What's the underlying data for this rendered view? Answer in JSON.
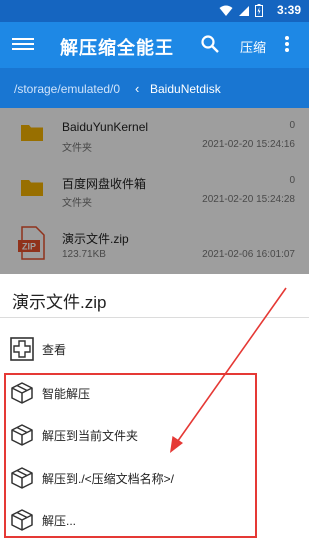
{
  "status_bar": {
    "time": "3:39"
  },
  "app_bar": {
    "title": "解压缩全能王",
    "compress_label": "压缩"
  },
  "path_bar": {
    "path": "/storage/emulated/0",
    "current_folder": "BaiduNetdisk"
  },
  "files": [
    {
      "name": "BaiduYunKernel",
      "type": "文件夹",
      "count": "0",
      "date": "2021-02-20 15:24:16",
      "icon": "folder-icon"
    },
    {
      "name": "百度网盘收件箱",
      "type": "文件夹",
      "count": "0",
      "date": "2021-02-20 15:24:28",
      "icon": "folder-icon"
    },
    {
      "name": "演示文件.zip",
      "size": "123.71KB",
      "date": "2021-02-06 16:01:07",
      "icon": "zip-file-icon",
      "icon_text": "ZIP"
    }
  ],
  "sheet": {
    "title": "演示文件.zip",
    "options": [
      {
        "label": "查看",
        "icon": "plus-square-icon"
      },
      {
        "label": "智能解压",
        "icon": "box-icon"
      },
      {
        "label": "解压到当前文件夹",
        "icon": "box-icon"
      },
      {
        "label": "解压到./<压缩文档名称>/",
        "icon": "box-icon"
      },
      {
        "label": "解压...",
        "icon": "box-icon"
      }
    ]
  },
  "colors": {
    "primary": "#1e88e5",
    "status_bar": "#1565c0",
    "path_bar": "#1976d2",
    "folder": "#f5b400",
    "zip": "#e8522d",
    "highlight": "#e53935"
  }
}
